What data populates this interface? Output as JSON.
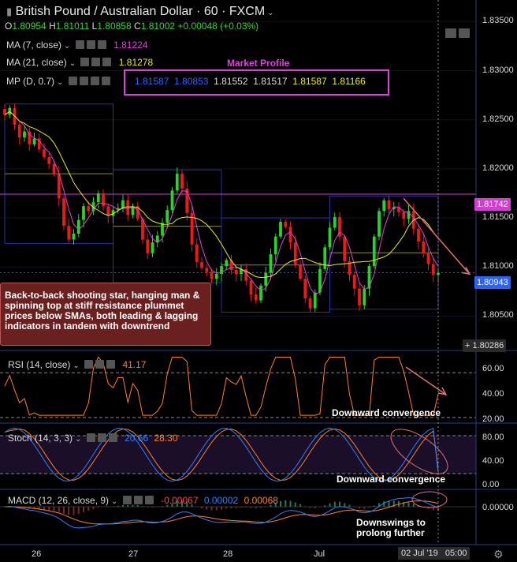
{
  "header": {
    "symbol": "British Pound / Australian Dollar",
    "interval": "60",
    "source": "FXCM",
    "ohlc": {
      "o_label": "O",
      "o": "1.80954",
      "h_label": "H",
      "h": "1.81011",
      "l_label": "L",
      "l": "1.80858",
      "c_label": "C",
      "c": "1.81002",
      "change": "+0.00048 (+0.03%)"
    }
  },
  "indicators": {
    "ma7": {
      "label": "MA (7, close)",
      "value": "1.81224"
    },
    "ma21": {
      "label": "MA (21, close)",
      "value": "1.81278"
    },
    "mp": {
      "label": "MP (D, 0.7)",
      "title": "Market Profile",
      "values": [
        "1.81587",
        "1.80853",
        "1.81552",
        "1.81517",
        "1.81587",
        "1.81166"
      ]
    },
    "rsi": {
      "label": "RSI (14, close)",
      "value": "41.17"
    },
    "stoch": {
      "label": "Stoch (14, 3, 3)",
      "k": "20.66",
      "d": "28.30"
    },
    "macd": {
      "label": "MACD (12, 26, close, 9)",
      "macd": "-0.00067",
      "signal": "0.00002",
      "hist": "0.00068"
    }
  },
  "annotations": {
    "main": "Back-to-back shooting star, hanging man & spinning top at stiff resistance plummet prices below SMAs, both leading & lagging indicators in tandem with downtrend",
    "rsi": "Downward convergence",
    "stoch": "Downward convergence",
    "macd_line1": "Downswings to",
    "macd_line2": "prolong further"
  },
  "axis": {
    "price_ticks": [
      "1.83500",
      "1.83000",
      "1.82500",
      "1.82000",
      "1.81500",
      "1.81000",
      "1.80500"
    ],
    "price_tag_resistance": "1.81742",
    "price_tag_current": "1.80943",
    "price_tag_crosshair": "1.80286",
    "rsi_ticks": [
      "60.00",
      "40.00",
      "20.00"
    ],
    "stoch_ticks": [
      "80.00",
      "40.00",
      "0.00"
    ],
    "macd_ticks": [
      "0.00000"
    ],
    "x_ticks": [
      "26",
      "27",
      "28",
      "Jul"
    ],
    "date_tag": "02 Jul '19",
    "time_tag": "05:00"
  },
  "colors": {
    "bull": "#26d626",
    "bear": "#f01818",
    "ma7": "#e040e0",
    "ma21": "#e8e820",
    "mp_box": "#e040e0",
    "resistance": "#d040d0",
    "rsi": "#ff7f27",
    "stoch_k": "#2f7fff",
    "stoch_d": "#ff7f27",
    "macd": "#2f7fff",
    "signal": "#ff7f27",
    "current_tag": "#2962ff",
    "annot_bg": "#6b2020"
  },
  "chart_data": {
    "type": "candlestick",
    "x_axis": {
      "ticks": [
        "26",
        "27",
        "28",
        "Jul"
      ]
    },
    "price_range": [
      1.8015,
      1.8372
    ],
    "resistance_level": 1.81742,
    "last_price": 1.80943,
    "closes": [
      1.8255,
      1.8262,
      1.8245,
      1.8232,
      1.8238,
      1.8225,
      1.8231,
      1.822,
      1.8212,
      1.8205,
      1.8195,
      1.817,
      1.8142,
      1.8128,
      1.8134,
      1.8148,
      1.8162,
      1.8157,
      1.8166,
      1.8175,
      1.8162,
      1.8152,
      1.8158,
      1.816,
      1.8168,
      1.8153,
      1.8162,
      1.8149,
      1.8128,
      1.8114,
      1.8125,
      1.8132,
      1.8145,
      1.8158,
      1.8178,
      1.8195,
      1.818,
      1.8155,
      1.8123,
      1.8105,
      1.8099,
      1.8095,
      1.8088,
      1.8093,
      1.8101,
      1.8107,
      1.8097,
      1.8093,
      1.8098,
      1.8086,
      1.8072,
      1.8066,
      1.8081,
      1.8094,
      1.8113,
      1.8131,
      1.8146,
      1.8141,
      1.8125,
      1.8102,
      1.8088,
      1.8068,
      1.8058,
      1.8074,
      1.8098,
      1.812,
      1.814,
      1.8151,
      1.8131,
      1.8106,
      1.8092,
      1.8078,
      1.8061,
      1.8078,
      1.8101,
      1.8131,
      1.8157,
      1.8168,
      1.8159,
      1.8161,
      1.8156,
      1.8149,
      1.8157,
      1.8139,
      1.8126,
      1.8114,
      1.8103,
      1.8092,
      1.8094
    ],
    "rsi": {
      "range": [
        15,
        80
      ],
      "ticks": [
        60,
        40,
        20
      ],
      "last": 41.17
    },
    "stoch": {
      "range": [
        -5,
        100
      ],
      "ticks": [
        80,
        40,
        0
      ],
      "k_last": 20.66,
      "d_last": 28.3
    },
    "macd": {
      "ticks": [
        0
      ],
      "macd_last": -0.00067,
      "signal_last": 2e-05,
      "hist_last": 0.00068
    }
  }
}
